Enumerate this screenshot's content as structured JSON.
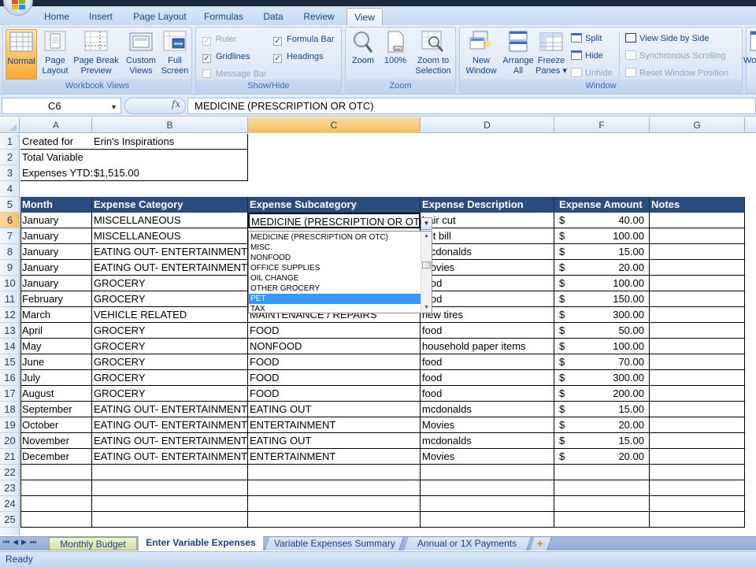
{
  "ribbon": {
    "tabs": [
      "Home",
      "Insert",
      "Page Layout",
      "Formulas",
      "Data",
      "Review",
      "View"
    ],
    "active_tab": "View",
    "groups": {
      "workbook_views": {
        "label": "Workbook Views",
        "buttons": {
          "normal": "Normal",
          "page_layout": [
            "Page",
            "Layout"
          ],
          "page_break_preview": [
            "Page Break",
            "Preview"
          ],
          "custom_views": [
            "Custom",
            "Views"
          ],
          "full_screen": [
            "Full",
            "Screen"
          ]
        }
      },
      "show_hide": {
        "label": "Show/Hide",
        "ruler": {
          "label": "Ruler",
          "checked": true,
          "enabled": false
        },
        "gridlines": {
          "label": "Gridlines",
          "checked": true,
          "enabled": true
        },
        "message_bar": {
          "label": "Message Bar",
          "checked": false,
          "enabled": false
        },
        "formula_bar": {
          "label": "Formula Bar",
          "checked": true,
          "enabled": true
        },
        "headings": {
          "label": "Headings",
          "checked": true,
          "enabled": true
        }
      },
      "zoom": {
        "label": "Zoom",
        "buttons": {
          "zoom": "Zoom",
          "hundred": "100%",
          "zoom_to_selection": [
            "Zoom to",
            "Selection"
          ]
        }
      },
      "window": {
        "label": "Window",
        "buttons": {
          "new_window": [
            "New",
            "Window"
          ],
          "arrange_all": [
            "Arrange",
            "All"
          ],
          "freeze_panes": [
            "Freeze",
            "Panes ▾"
          ],
          "split": "Split",
          "hide": "Hide",
          "unhide": "Unhide",
          "view_side_by_side": "View Side by Side",
          "synchronous_scrolling": "Synchronous Scrolling",
          "reset_window_position": "Reset Window Position",
          "workspace_partial": "Wo"
        }
      }
    }
  },
  "formula_bar": {
    "name_box": "C6",
    "fx_label": "fx",
    "content": "MEDICINE (PRESCRIPTION OR OTC)"
  },
  "sheet": {
    "columns": [
      "A",
      "B",
      "C",
      "D",
      "F",
      "G"
    ],
    "selected_column": "C",
    "selected_row": 6,
    "row_numbers": [
      "1",
      "2",
      "3",
      "4",
      "5",
      "6",
      "7",
      "8",
      "9",
      "10",
      "11",
      "12",
      "13",
      "14",
      "15",
      "16",
      "17",
      "18",
      "19",
      "20",
      "21",
      "22",
      "23",
      "24",
      "25"
    ],
    "info": {
      "created_for_label": "Created for",
      "created_for_value": "Erin's Inspirations",
      "total_label_1": "Total Variable",
      "total_label_2": "Expenses YTD:",
      "total_value": "$1,515.00"
    },
    "table_headers": [
      "Month",
      "Expense Category",
      "Expense Subcategory",
      "Expense Description",
      "Expense Amount",
      "Notes"
    ],
    "rows": [
      {
        "month": "January",
        "category": "MISCELLANEOUS",
        "subcategory": "MEDICINE (PRESCRIPTION OR OTC)",
        "description": "hair cut",
        "amount": "40.00",
        "notes": ""
      },
      {
        "month": "January",
        "category": "MISCELLANEOUS",
        "subcategory": "",
        "description": "vet bill",
        "amount": "100.00",
        "notes": ""
      },
      {
        "month": "January",
        "category": "EATING OUT- ENTERTAINMENT",
        "subcategory": "",
        "description": "mcdonalds",
        "amount": "15.00",
        "notes": ""
      },
      {
        "month": "January",
        "category": "EATING OUT- ENTERTAINMENT",
        "subcategory": "",
        "description": "movies",
        "amount": "20.00",
        "notes": ""
      },
      {
        "month": "January",
        "category": "GROCERY",
        "subcategory": "",
        "description": "food",
        "amount": "100.00",
        "notes": ""
      },
      {
        "month": "February",
        "category": "GROCERY",
        "subcategory": "",
        "description": "food",
        "amount": "150.00",
        "notes": ""
      },
      {
        "month": "March",
        "category": "VEHICLE RELATED",
        "subcategory": "MAINTENANCE / REPAIRS",
        "description": "new tires",
        "amount": "300.00",
        "notes": ""
      },
      {
        "month": "April",
        "category": "GROCERY",
        "subcategory": "FOOD",
        "description": "food",
        "amount": "50.00",
        "notes": ""
      },
      {
        "month": "May",
        "category": "GROCERY",
        "subcategory": "NONFOOD",
        "description": "household paper items",
        "amount": "100.00",
        "notes": ""
      },
      {
        "month": "June",
        "category": "GROCERY",
        "subcategory": "FOOD",
        "description": "food",
        "amount": "70.00",
        "notes": ""
      },
      {
        "month": "July",
        "category": "GROCERY",
        "subcategory": "FOOD",
        "description": "food",
        "amount": "300.00",
        "notes": ""
      },
      {
        "month": "August",
        "category": "GROCERY",
        "subcategory": "FOOD",
        "description": "food",
        "amount": "200.00",
        "notes": ""
      },
      {
        "month": "September",
        "category": "EATING OUT- ENTERTAINMENT",
        "subcategory": "EATING OUT",
        "description": "mcdonalds",
        "amount": "15.00",
        "notes": ""
      },
      {
        "month": "October",
        "category": "EATING OUT- ENTERTAINMENT",
        "subcategory": "ENTERTAINMENT",
        "description": "Movies",
        "amount": "20.00",
        "notes": ""
      },
      {
        "month": "November",
        "category": "EATING OUT- ENTERTAINMENT",
        "subcategory": "EATING OUT",
        "description": "mcdonalds",
        "amount": "15.00",
        "notes": ""
      },
      {
        "month": "December",
        "category": "EATING OUT- ENTERTAINMENT",
        "subcategory": "ENTERTAINMENT",
        "description": "Movies",
        "amount": "20.00",
        "notes": ""
      }
    ],
    "currency_symbol": "$",
    "header_color": "#2b4c7e"
  },
  "dropdown": {
    "items": [
      "MEDICINE (PRESCRIPTION OR OTC)",
      "MISC.",
      "NONFOOD",
      "OFFICE SUPPLIES",
      "OIL CHANGE",
      "OTHER GROCERY",
      "PET",
      "TAX"
    ],
    "highlighted": "PET",
    "highlight_color": "#3399ff"
  },
  "sheet_tabs": {
    "tabs": [
      "Monthly Budget",
      "Enter Variable Expenses",
      "Variable Expenses Summary",
      "Annual or 1X Payments"
    ],
    "active": "Enter Variable Expenses"
  },
  "status": {
    "text": "Ready"
  }
}
